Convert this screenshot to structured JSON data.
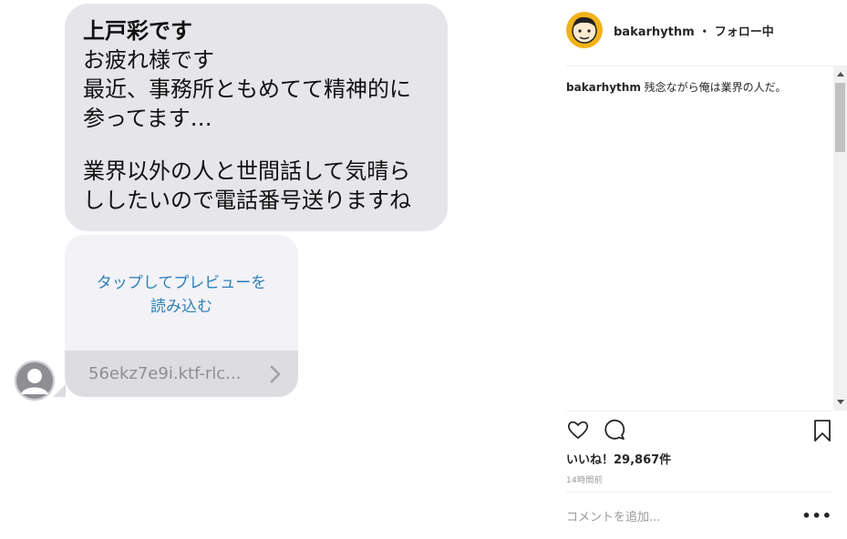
{
  "chat": {
    "message": {
      "sender": "上戸彩です",
      "lines": [
        "お疲れ様です",
        "最近、事務所ともめてて精神的に",
        "参ってます…"
      ],
      "lines2": [
        "業界以外の人と世間話して気晴ら",
        "ししたいので電話番号送りますね"
      ]
    },
    "link_preview": {
      "tap_text_1": "タップしてプレビューを",
      "tap_text_2": "読み込む",
      "url": "56ekz7e9i.ktf-rlc..."
    }
  },
  "instagram": {
    "username": "bakarhythm",
    "separator": "・",
    "follow_label": "フォロー中",
    "caption_user": "bakarhythm",
    "caption_text": "残念ながら俺は業界の人だ。",
    "likes_label": "いいね！29,867件",
    "time_label": "14時間前",
    "comment_placeholder": "コメントを追加...",
    "more_label": "•••",
    "avatar_color": "#f2b21a",
    "link_color": "#2f80b6"
  }
}
